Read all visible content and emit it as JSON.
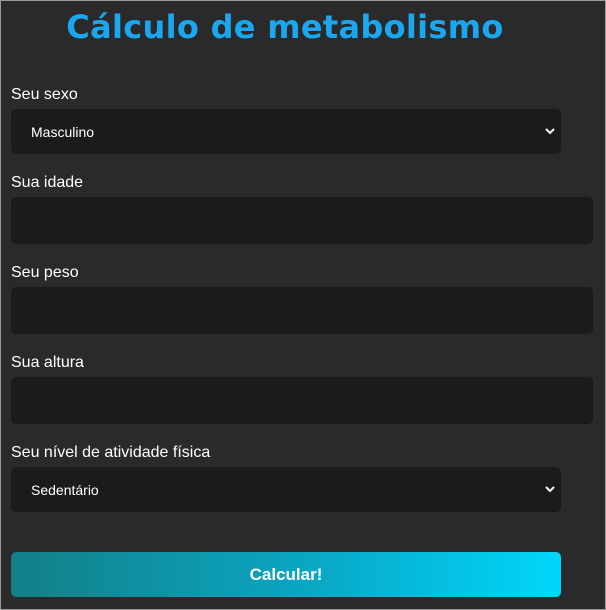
{
  "title": "Cálculo de metabolismo",
  "form": {
    "sex": {
      "label": "Seu sexo",
      "selected": "Masculino"
    },
    "age": {
      "label": "Sua idade",
      "value": ""
    },
    "weight": {
      "label": "Seu peso",
      "value": ""
    },
    "height": {
      "label": "Sua altura",
      "value": ""
    },
    "activity": {
      "label": "Seu nível de atividade física",
      "selected": "Sedentário"
    },
    "submit_label": "Calcular!"
  },
  "colors": {
    "background": "#2a2a2a",
    "title": "#1aa7f0",
    "field_background": "#1b1b1b",
    "button_gradient_start": "#127f86",
    "button_gradient_end": "#00d6fb"
  }
}
